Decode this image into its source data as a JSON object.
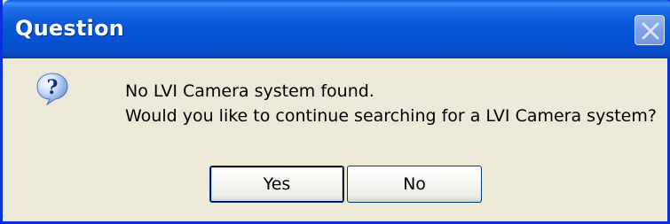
{
  "dialog": {
    "title": "Question",
    "close_icon": "close-icon",
    "icon": "question-icon",
    "message_lines": [
      "No LVI Camera system found.",
      "Would you like to continue searching for a LVI Camera system?"
    ],
    "buttons": {
      "yes": "Yes",
      "no": "No"
    }
  },
  "colors": {
    "titlebar": "#0a58d8",
    "face": "#ece9d8",
    "border": "#0831d9",
    "text": "#000000"
  }
}
